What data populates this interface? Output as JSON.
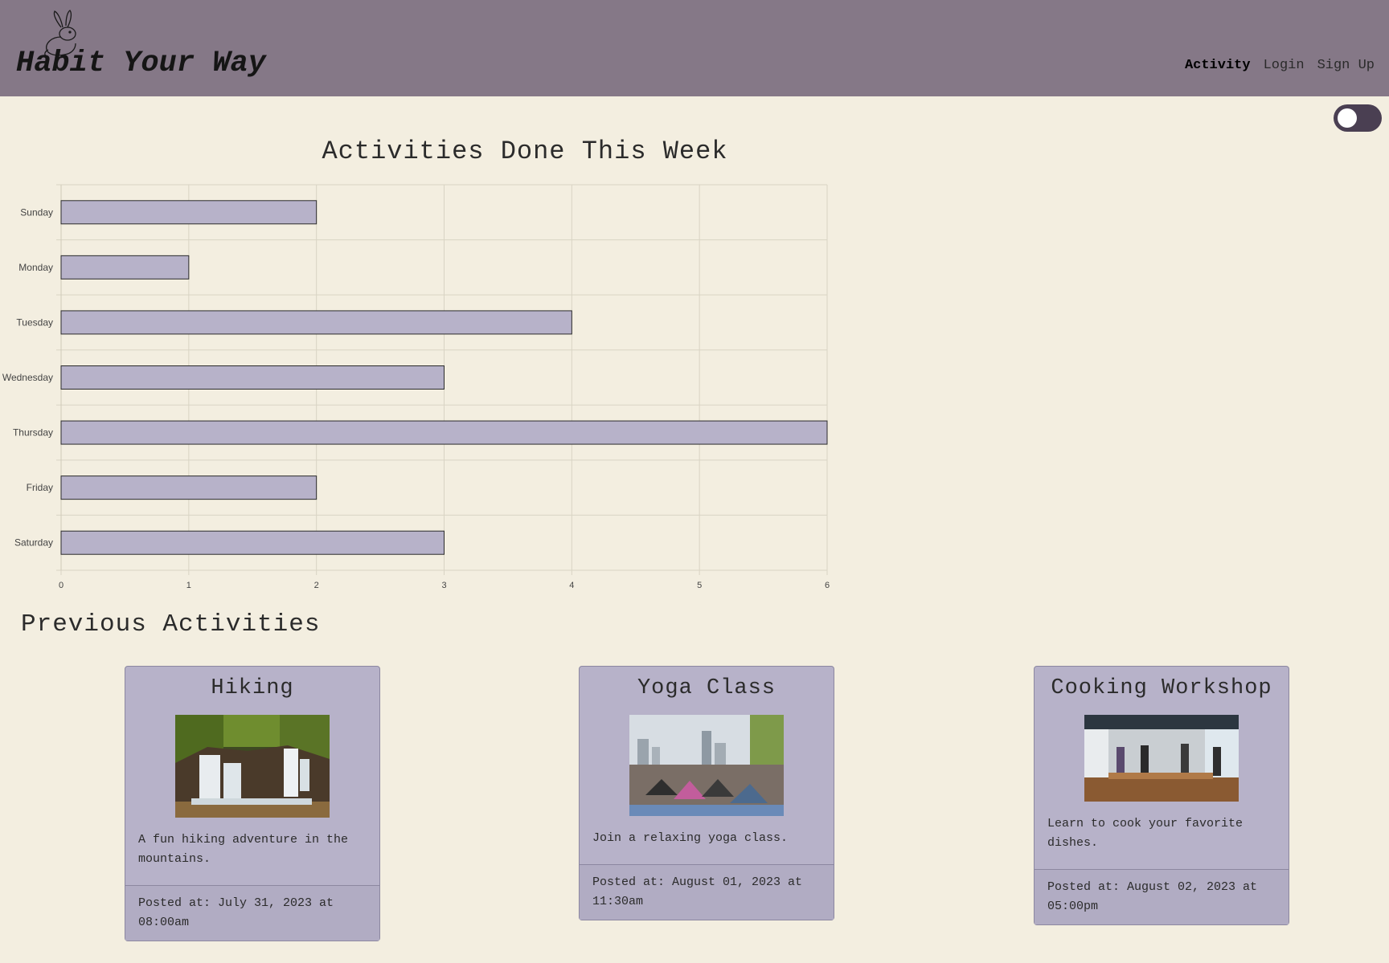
{
  "header": {
    "brand": "Habit Your Way",
    "nav": [
      {
        "label": "Activity",
        "active": true
      },
      {
        "label": "Login",
        "active": false
      },
      {
        "label": "Sign Up",
        "active": false
      }
    ]
  },
  "theme_toggle": {
    "state": "off"
  },
  "chart_title": "Activities Done This Week",
  "chart_data": {
    "type": "bar",
    "orientation": "horizontal",
    "categories": [
      "Sunday",
      "Monday",
      "Tuesday",
      "Wednesday",
      "Thursday",
      "Friday",
      "Saturday"
    ],
    "values": [
      2,
      1,
      4,
      3,
      6,
      2,
      3
    ],
    "xlim": [
      0,
      6
    ],
    "xticks": [
      "0",
      "1",
      "2",
      "3",
      "4",
      "5",
      "6"
    ],
    "grid": true,
    "bar_color": "#b7b2c9",
    "bar_border_color": "#2b2b2b"
  },
  "previous": {
    "title": "Previous Activities",
    "cards": [
      {
        "title": "Hiking",
        "image": "waterfall-photo",
        "description": "A fun hiking adventure in the mountains.",
        "posted": "Posted at: July 31, 2023 at 08:00am"
      },
      {
        "title": "Yoga Class",
        "image": "yoga-photo",
        "description": "Join a relaxing yoga class.",
        "posted": "Posted at: August 01, 2023 at 11:30am"
      },
      {
        "title": "Cooking Workshop",
        "image": "kitchen-photo",
        "description": "Learn to cook your favorite dishes.",
        "posted": "Posted at: August 02, 2023 at 05:00pm"
      }
    ]
  },
  "colors": {
    "header_bg": "#857887",
    "page_bg": "#f3eee0",
    "card_bg": "#b7b2c9",
    "toggle_bg": "#4a3f52"
  }
}
